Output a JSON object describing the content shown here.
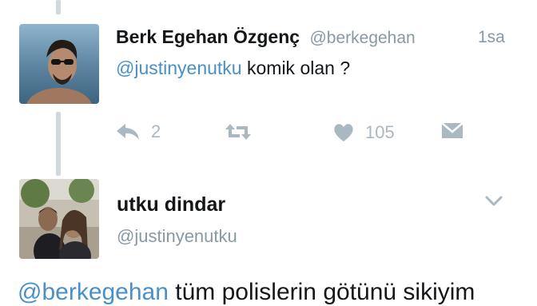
{
  "reply": {
    "display_name": "Berk Egehan Özgenç",
    "handle": "@berkegehan",
    "time": "1sa",
    "mention": "@justinyenutku",
    "text": " komik olan ?",
    "actions": {
      "reply_icon": "reply-icon",
      "reply_count": "2",
      "retweet_icon": "retweet-icon",
      "like_icon": "heart-icon",
      "like_count": "105",
      "dm_icon": "envelope-icon"
    }
  },
  "original": {
    "display_name": "utku dindar",
    "handle": "@justinyenutku",
    "menu_icon": "chevron-down-icon",
    "mention": "@berkegehan",
    "text": " tüm polislerin götünü sikiyim"
  },
  "colors": {
    "link": "#4a90c8",
    "muted": "#8899a6",
    "icon": "#aab8c2",
    "thread_line": "#cfd9de"
  }
}
